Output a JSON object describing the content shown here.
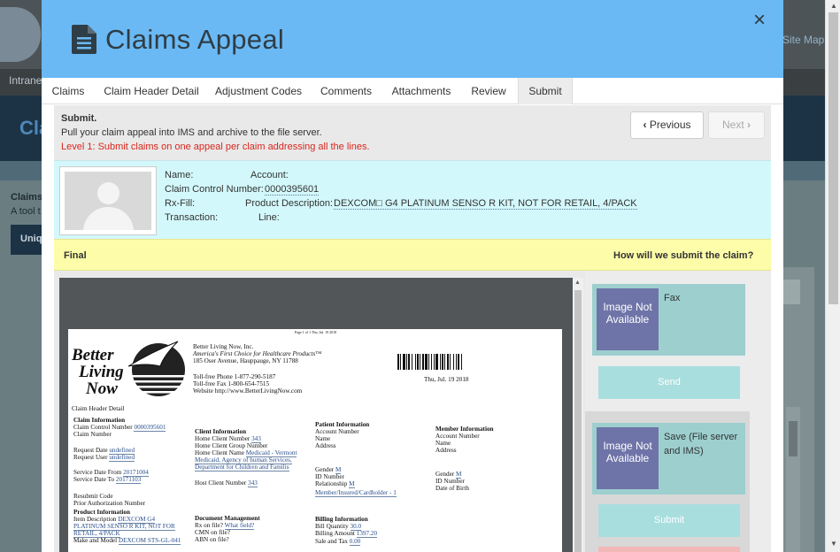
{
  "background": {
    "site_map": "Site Map",
    "intranet": "Intranet",
    "banner_title": "Cla",
    "claims_title": "Claims",
    "claims_sub": "A tool t",
    "uniq_button": "Uniq"
  },
  "modal": {
    "title": "Claims Appeal",
    "close": "×",
    "tabs": [
      {
        "label": "Claims"
      },
      {
        "label": "Claim Header Detail"
      },
      {
        "label": "Adjustment Codes"
      },
      {
        "label": "Comments"
      },
      {
        "label": "Attachments"
      },
      {
        "label": "Review"
      },
      {
        "label": "Submit"
      }
    ],
    "submit": {
      "title": "Submit.",
      "description": "Pull your claim appeal into IMS and archive to the file server.",
      "level_note": "Level 1: Submit claims on one appeal per claim addressing all the lines."
    },
    "nav": {
      "previous": "Previous",
      "next": "Next"
    },
    "info": {
      "name_label": "Name:",
      "account_label": "Account:",
      "ccn_label": "Claim Control Number:",
      "ccn_value": "0000395601",
      "rxfill_label": "Rx-Fill:",
      "product_label": "Product Description:",
      "product_value": "DEXCOM□ G4 PLATINUM SENSO R KIT, NOT FOR RETAIL, 4/PACK",
      "transaction_label": "Transaction:",
      "line_label": "Line:"
    },
    "final_label": "Final",
    "how_question": "How will we submit the claim?",
    "document": {
      "page_header": "Page 1 of 1 Thu, Jul. 19 2018",
      "logo_line1": "Better",
      "logo_line2": "Living",
      "logo_line3": "Now",
      "company": "Better Living Now, Inc.",
      "tagline": "America's First Choice for Healthcare Products™",
      "address": "185 Oser Avenue, Hauppauge, NY 11788",
      "phone": "Toll-free Phone 1-877-290-5187",
      "fax": "Toll-free Fax 1-800-654-7515",
      "website": "Website http://www.BetterLivingNow.com",
      "date": "Thu, Jul. 19 2018",
      "section_title": "Claim Header Detail",
      "claim_info": "Claim Information",
      "ccn_label": "Claim Control Number",
      "ccn_value": "0000395601",
      "claim_number": "Claim Number",
      "request_date": "Request Date",
      "request_user": "Request User",
      "undefined": "undefined",
      "service_from": "Service Date From",
      "service_from_value": "20171004",
      "service_to": "Service Date To",
      "service_to_value": "20171103",
      "resubmit": "Resubmit Code",
      "prior_auth": "Prior Authorization Number",
      "product_info": "Product Information",
      "item_desc": "Item Description",
      "item_desc_value_1": "DEXCOM G4",
      "item_desc_value_2": "PLATINUM SENSO R KIT, NOT FOR",
      "item_desc_value_3": "RETAIL, 4/PACK",
      "make_model": "Make and Model",
      "make_model_value": "DEXCOM STS-GL-041",
      "client_info": "Client Information",
      "home_client_number": "Home Client Number",
      "home_client_number_value": "343",
      "home_client_group": "Home Client Group Number",
      "home_client_name": "Home Client Name",
      "home_client_name_value_1": "Medicaid - Vermont",
      "home_client_name_value_2": "Medicaid, Agency of human Services,",
      "home_client_name_value_3": "Department for Children and Familis",
      "host_client_number": "Host Client Number",
      "host_client_number_value": "343",
      "doc_mgmt": "Document Management",
      "rx_on_file": "Rx on file?",
      "what_field": "What field?",
      "cmn_on_file": "CMN on file?",
      "abn_on_file": "ABN on file?",
      "patient_info": "Patient Information",
      "account_number": "Account Number",
      "name": "Name",
      "address_label": "Address",
      "gender": "Gender",
      "gender_value": "M",
      "id_number": "ID Number",
      "relationship": "Relationship",
      "relationship_value": "M",
      "relationship_value_2": "Member/Insured/Cardholder - 1",
      "billing_info": "Billing Information",
      "bill_quantity": "Bill Quantity",
      "bill_quantity_value": "30.0",
      "billing_amount": "Billing Amount",
      "billing_amount_value": "1397.20",
      "sale_tax": "Sale and Tax",
      "sale_tax_value": "0.00",
      "member_info": "Member Information",
      "member_gender_value": "M",
      "date_of_birth": "Date of Birth"
    },
    "options": [
      {
        "image_text": "Image Not Available",
        "label": "Fax",
        "button": "Send"
      },
      {
        "image_text": "Image Not Available",
        "label": "Save (File server and IMS)",
        "button": "Submit"
      }
    ]
  }
}
